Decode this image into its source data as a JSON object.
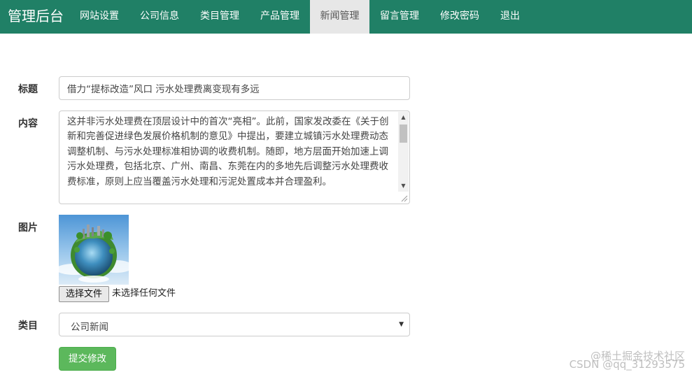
{
  "header": {
    "brand": "管理后台",
    "nav": [
      {
        "label": "网站设置",
        "active": false
      },
      {
        "label": "公司信息",
        "active": false
      },
      {
        "label": "类目管理",
        "active": false
      },
      {
        "label": "产品管理",
        "active": false
      },
      {
        "label": "新闻管理",
        "active": true
      },
      {
        "label": "留言管理",
        "active": false
      },
      {
        "label": "修改密码",
        "active": false
      },
      {
        "label": "退出",
        "active": false
      }
    ]
  },
  "form": {
    "title_label": "标题",
    "title_value": "借力“提标改造”风口 污水处理费离变现有多远",
    "content_label": "内容",
    "content_value": "这并非污水处理费在顶层设计中的首次“亮相”。此前，国家发改委在《关于创新和完善促进绿色发展价格机制的意见》中提出，要建立城镇污水处理费动态调整机制、与污水处理标准相协调的收费机制。随即，地方层面开始加速上调污水处理费，包括北京、广州、南昌、东莞在内的多地先后调整污水处理费收费标准，原则上应当覆盖污水处理和污泥处置成本并合理盈利。",
    "image_label": "图片",
    "file_button": "选择文件",
    "file_status": "未选择任何文件",
    "category_label": "类目",
    "category_value": "公司新闻",
    "submit_label": "提交修改"
  },
  "watermark": {
    "line1": "@稀土掘金技术社区",
    "line2": "CSDN @qq_31293575"
  },
  "colors": {
    "navbar": "#208066",
    "nav_active_bg": "#e7e7e7",
    "submit_button": "#5cb85c"
  },
  "icons": {
    "select_arrow": "caret-down-icon",
    "scroll_up": "arrow-up-icon",
    "scroll_down": "arrow-down-icon"
  }
}
